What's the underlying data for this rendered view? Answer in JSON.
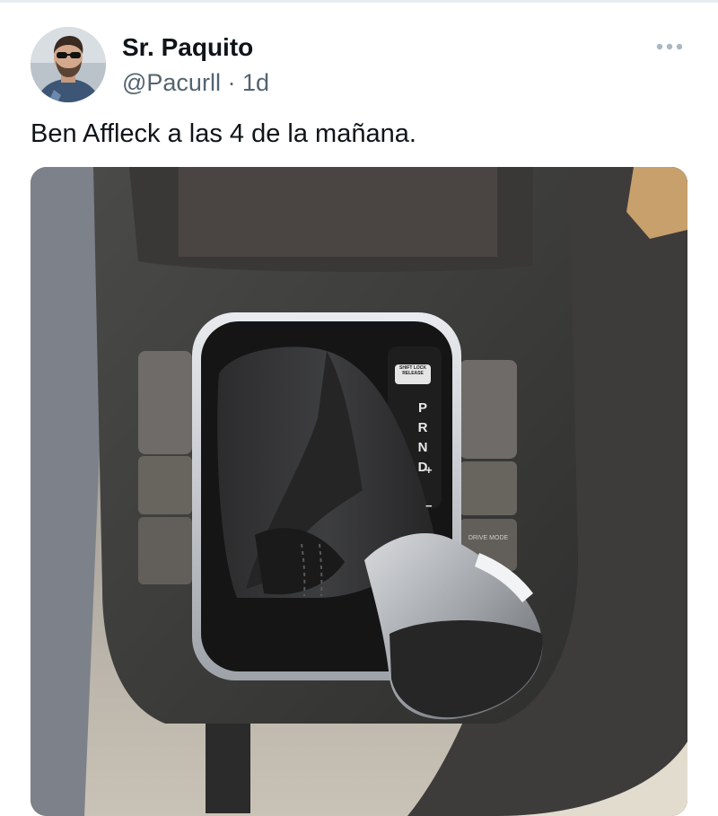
{
  "tweet": {
    "author": {
      "display_name": "Sr. Paquito",
      "handle": "@Pacurll",
      "separator": "·",
      "time_ago": "1d"
    },
    "text": "Ben Affleck a las 4 de la mañana.",
    "more_icon": "more-horizontal-icon",
    "media": {
      "shifter_positions": [
        "P",
        "R",
        "N",
        "D"
      ],
      "shifter_signs": [
        "+",
        "−"
      ],
      "badge_top": "SHIFT LOCK RELEASE",
      "badge_bottom": "DRIVE MODE"
    }
  },
  "colors": {
    "text_primary": "#0f1419",
    "text_secondary": "#536471",
    "divider": "#e6ecf0"
  }
}
